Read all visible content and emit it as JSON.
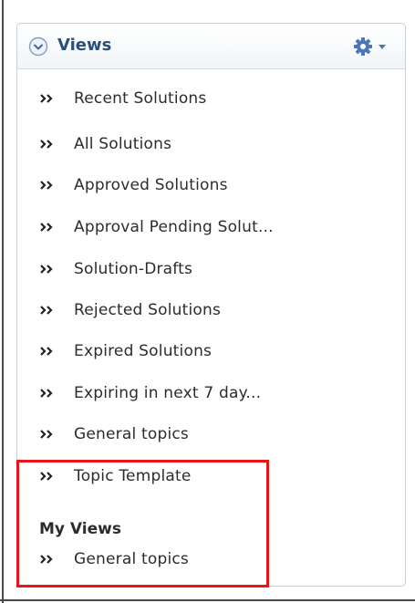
{
  "panel": {
    "title": "Views",
    "items": [
      {
        "label": "Recent Solutions"
      },
      {
        "label": "All Solutions"
      },
      {
        "label": "Approved Solutions"
      },
      {
        "label": "Approval Pending Solut..."
      },
      {
        "label": "Solution-Drafts"
      },
      {
        "label": "Rejected Solutions"
      },
      {
        "label": "Expired Solutions"
      },
      {
        "label": "Expiring in next 7 day..."
      },
      {
        "label": "General topics"
      },
      {
        "label": "Topic Template"
      }
    ],
    "my_views": {
      "heading": "My Views",
      "items": [
        {
          "label": "General topics"
        }
      ]
    }
  },
  "icons": {
    "collapse": "circle-chevron-down-icon",
    "settings": "gear-dropdown-icon",
    "item_bullet": "double-chevron-right-icon"
  },
  "colors": {
    "title": "#2a4f7d",
    "icon_blue": "#4a78b5",
    "highlight": "#e8141a"
  }
}
